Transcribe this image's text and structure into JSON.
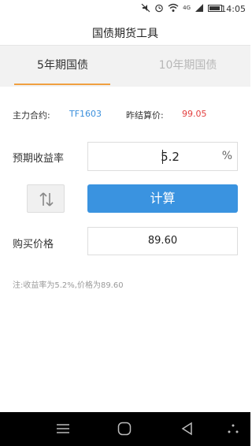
{
  "statusbar": {
    "time": "14:05",
    "network_label": "4G",
    "icons": [
      "mute-icon",
      "alarm-icon",
      "wifi-icon",
      "signal-icon",
      "battery-icon"
    ]
  },
  "header": {
    "title": "国债期货工具"
  },
  "tabs": [
    {
      "label": "5年期国债",
      "active": true
    },
    {
      "label": "10年期国债",
      "active": false
    }
  ],
  "contract": {
    "main_label": "主力合约:",
    "main_value": "TF1603",
    "settle_label": "昨结算价:",
    "settle_value": "99.05"
  },
  "yield": {
    "label": "预期收益率",
    "value": "5.2",
    "unit": "%"
  },
  "actions": {
    "swap_icon": "swap-vertical-icon",
    "calculate_label": "计算"
  },
  "price": {
    "label": "购买价格",
    "value": "89.60"
  },
  "note": "注:收益率为5.2%,价格为89.60",
  "colors": {
    "accent_blue": "#3a93e0",
    "contract_blue": "#3a8fdc",
    "settle_red": "#e34040",
    "tab_indicator": "#f0a040"
  },
  "navbar": [
    "menu-icon",
    "home-icon",
    "back-icon",
    "assist-icon"
  ]
}
